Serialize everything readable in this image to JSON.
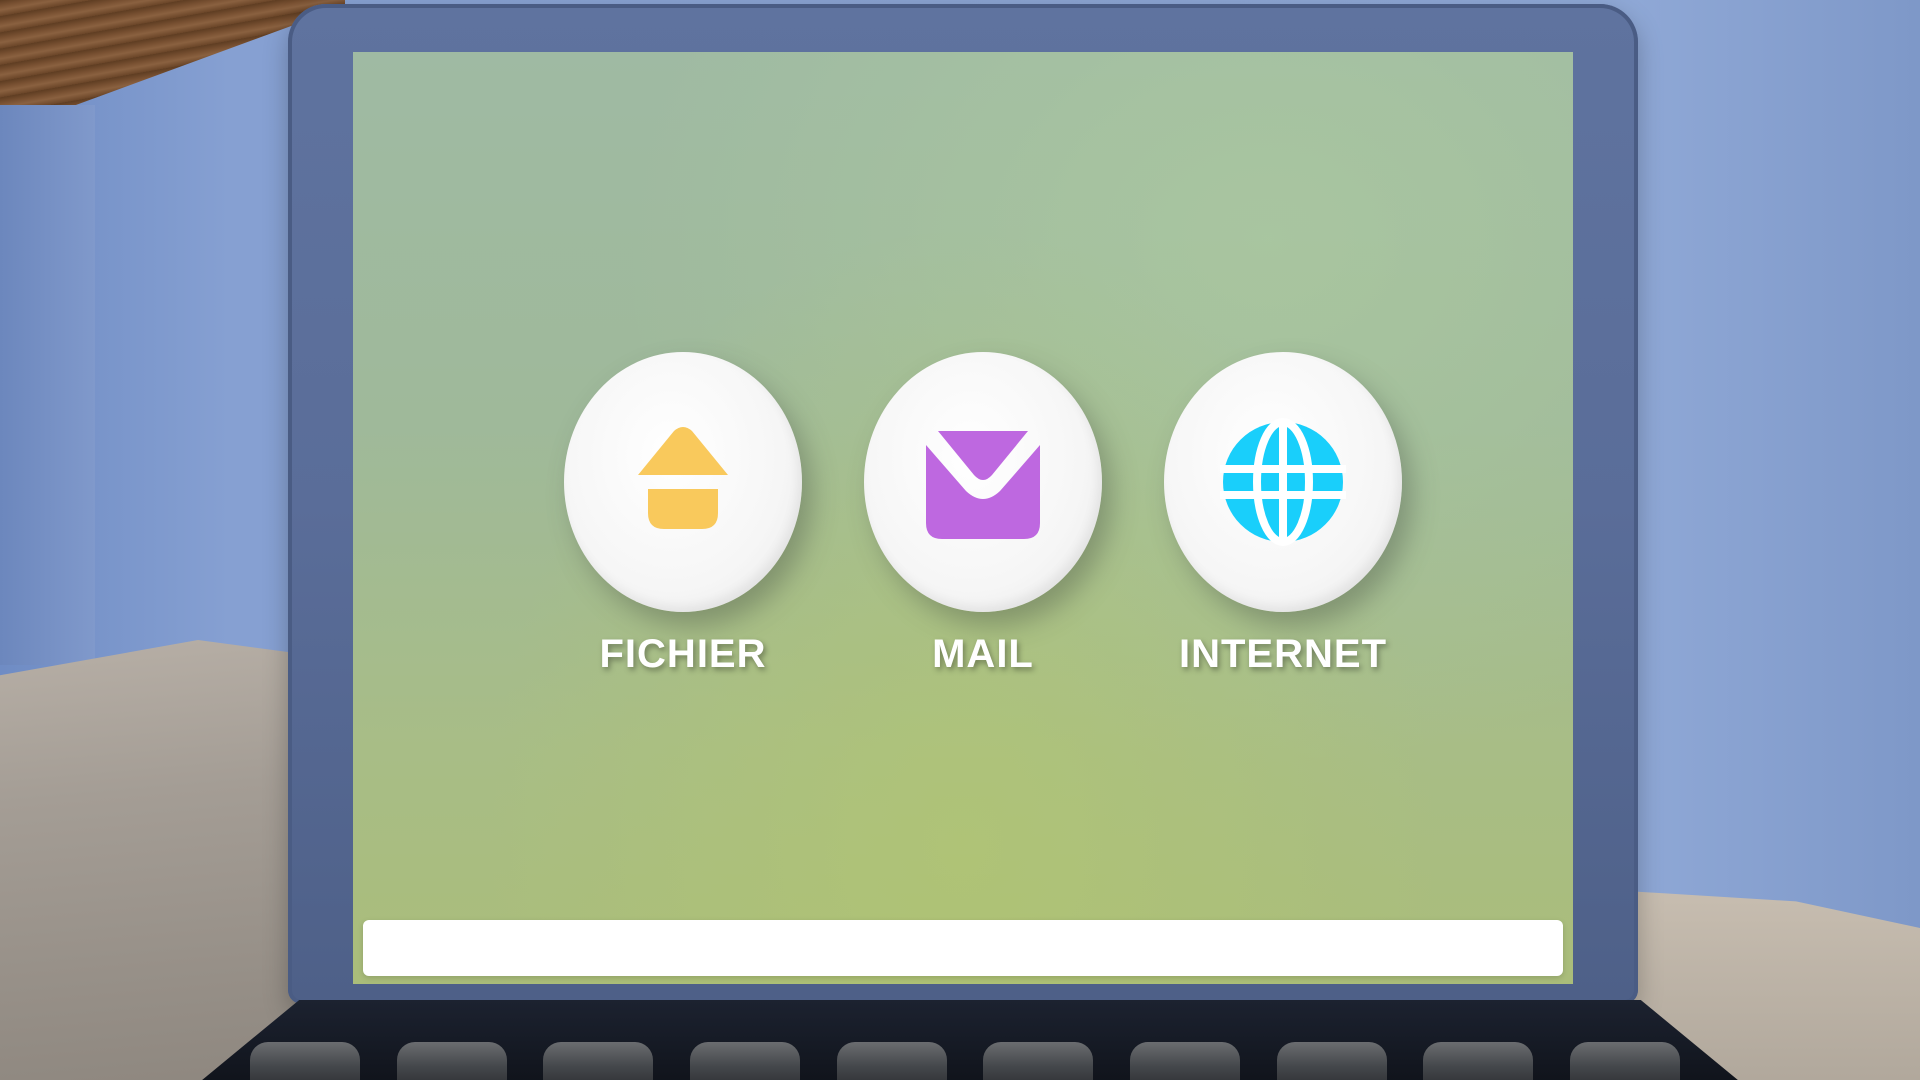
{
  "desktop": {
    "apps": [
      {
        "label": "FICHIER",
        "icon": "home-icon",
        "color": "#F9C95C"
      },
      {
        "label": "MAIL",
        "icon": "envelope-icon",
        "color": "#BE68E0"
      },
      {
        "label": "INTERNET",
        "icon": "globe-icon",
        "color": "#19CFFB"
      }
    ]
  },
  "taskbar": {
    "label": ""
  },
  "colors": {
    "screen_background": "#A2BC96",
    "laptop_frame": "#5A6D99",
    "wall": "#8AA3D1"
  }
}
